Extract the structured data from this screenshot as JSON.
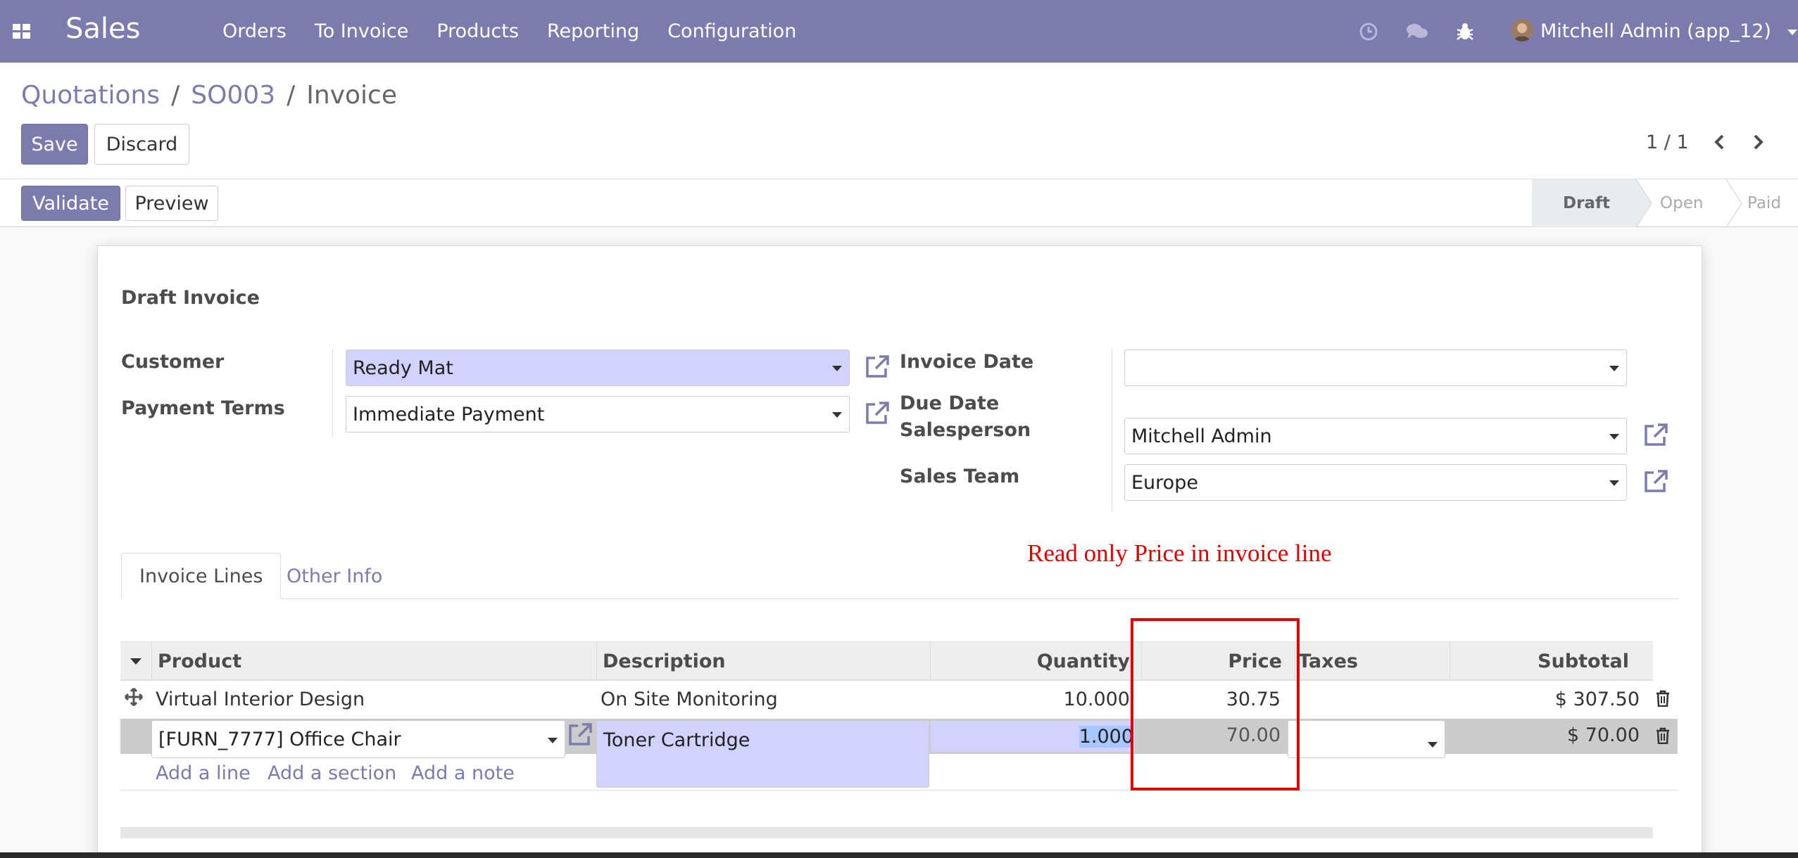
{
  "navbar": {
    "brand": "Sales",
    "menu": [
      "Orders",
      "To Invoice",
      "Products",
      "Reporting",
      "Configuration"
    ],
    "user": "Mitchell Admin (app_12)"
  },
  "breadcrumb": {
    "items": [
      "Quotations",
      "SO003"
    ],
    "current": "Invoice",
    "separator": "/"
  },
  "buttons": {
    "save": "Save",
    "discard": "Discard",
    "validate": "Validate",
    "preview": "Preview"
  },
  "pager": {
    "value": "1 / 1"
  },
  "statusbar": {
    "steps": [
      "Draft",
      "Open",
      "Paid"
    ],
    "active": "Draft"
  },
  "form": {
    "title": "Draft Invoice",
    "customer": {
      "label": "Customer",
      "value": "Ready Mat"
    },
    "payment_terms": {
      "label": "Payment Terms",
      "value": "Immediate Payment"
    },
    "invoice_date": {
      "label": "Invoice Date",
      "value": ""
    },
    "due_date": {
      "label": "Due Date"
    },
    "salesperson": {
      "label": "Salesperson",
      "value": "Mitchell Admin"
    },
    "sales_team": {
      "label": "Sales Team",
      "value": "Europe"
    }
  },
  "annotation": "Read only Price in invoice line",
  "tabs": [
    "Invoice Lines",
    "Other Info"
  ],
  "table": {
    "columns": [
      "Product",
      "Description",
      "Quantity",
      "Price",
      "Taxes",
      "Subtotal"
    ],
    "rows": [
      {
        "product": "Virtual Interior Design",
        "description": "On Site Monitoring",
        "quantity": "10.000",
        "price": "30.75",
        "taxes": "",
        "subtotal": "$ 307.50"
      }
    ],
    "edit_row": {
      "product": "[FURN_7777] Office Chair",
      "description": "Toner Cartridge",
      "quantity": "1.000",
      "price": "70.00",
      "taxes": "",
      "subtotal": "$ 70.00"
    },
    "add_links": [
      "Add a line",
      "Add a section",
      "Add a note"
    ]
  },
  "colors": {
    "brand": "#7c7bad",
    "annotation": "#e00000",
    "required_field": "#d2d2ff"
  }
}
